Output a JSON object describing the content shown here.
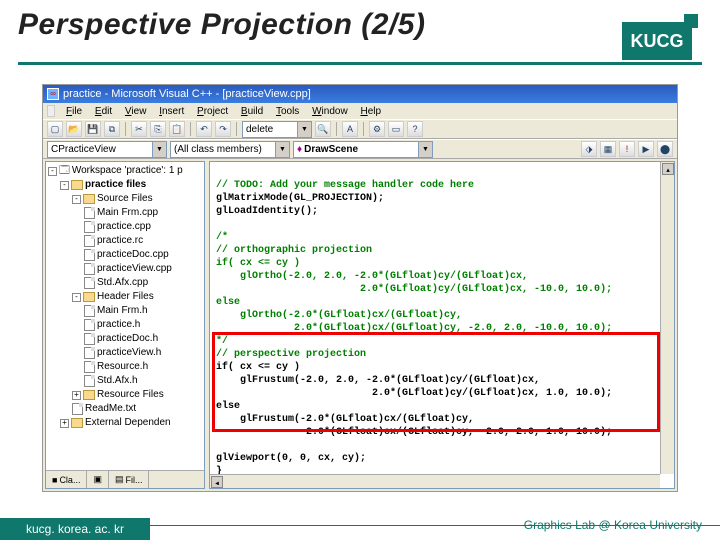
{
  "slide": {
    "title": "Perspective Projection (2/5)",
    "badge": "KUCG",
    "footer_left": "kucg. korea. ac. kr",
    "footer_right": "Graphics Lab @ Korea University"
  },
  "ide": {
    "window_title": "practice - Microsoft Visual C++ - [practiceView.cpp]",
    "menus": [
      "File",
      "Edit",
      "View",
      "Insert",
      "Project",
      "Build",
      "Tools",
      "Window",
      "Help"
    ],
    "combo_class": "CPracticeView",
    "combo_filter": "(All class members)",
    "combo_func": "DrawScene",
    "delete_btn": "delete",
    "tree": {
      "root": "Workspace 'practice': 1 p",
      "proj": "practice files",
      "folders": [
        {
          "name": "Source Files",
          "items": [
            "Main Frm.cpp",
            "practice.cpp",
            "practice.rc",
            "practiceDoc.cpp",
            "practiceView.cpp",
            "Std.Afx.cpp"
          ]
        },
        {
          "name": "Header Files",
          "items": [
            "Main Frm.h",
            "practice.h",
            "practiceDoc.h",
            "practiceView.h",
            "Resource.h",
            "Std.Afx.h"
          ]
        },
        {
          "name": "Resource Files",
          "items": []
        }
      ],
      "extra": [
        "ReadMe.txt",
        "External Dependen"
      ],
      "tabs": [
        "Cla...",
        "",
        "Fil..."
      ]
    },
    "code": {
      "l1": "// TODO: Add your message handler code here",
      "l2": "glMatrixMode(GL_PROJECTION);",
      "l3": "glLoadIdentity();",
      "l4": "",
      "l5": "/*",
      "l6": "// orthographic projection",
      "l7": "if( cx <= cy )",
      "l8": "    glOrtho(-2.0, 2.0, -2.0*(GLfloat)cy/(GLfloat)cx,",
      "l9": "                        2.0*(GLfloat)cy/(GLfloat)cx, -10.0, 10.0);",
      "l10": "else",
      "l11": "    glOrtho(-2.0*(GLfloat)cx/(GLfloat)cy,",
      "l12": "             2.0*(GLfloat)cx/(GLfloat)cy, -2.0, 2.0, -10.0, 10.0);",
      "l13": "*/",
      "l14": "// perspective projection",
      "l15": "if( cx <= cy )",
      "l16": "    glFrustum(-2.0, 2.0, -2.0*(GLfloat)cy/(GLfloat)cx,",
      "l17": "                          2.0*(GLfloat)cy/(GLfloat)cx, 1.0, 10.0);",
      "l18": "else",
      "l19": "    glFrustum(-2.0*(GLfloat)cx/(GLfloat)cy,",
      "l20": "               2.0*(GLfloat)cx/(GLfloat)cy, -2.0, 2.0, 1.0, 10.0);",
      "l21": "",
      "l22": "glViewport(0, 0, cx, cy);",
      "l23": "}"
    }
  }
}
